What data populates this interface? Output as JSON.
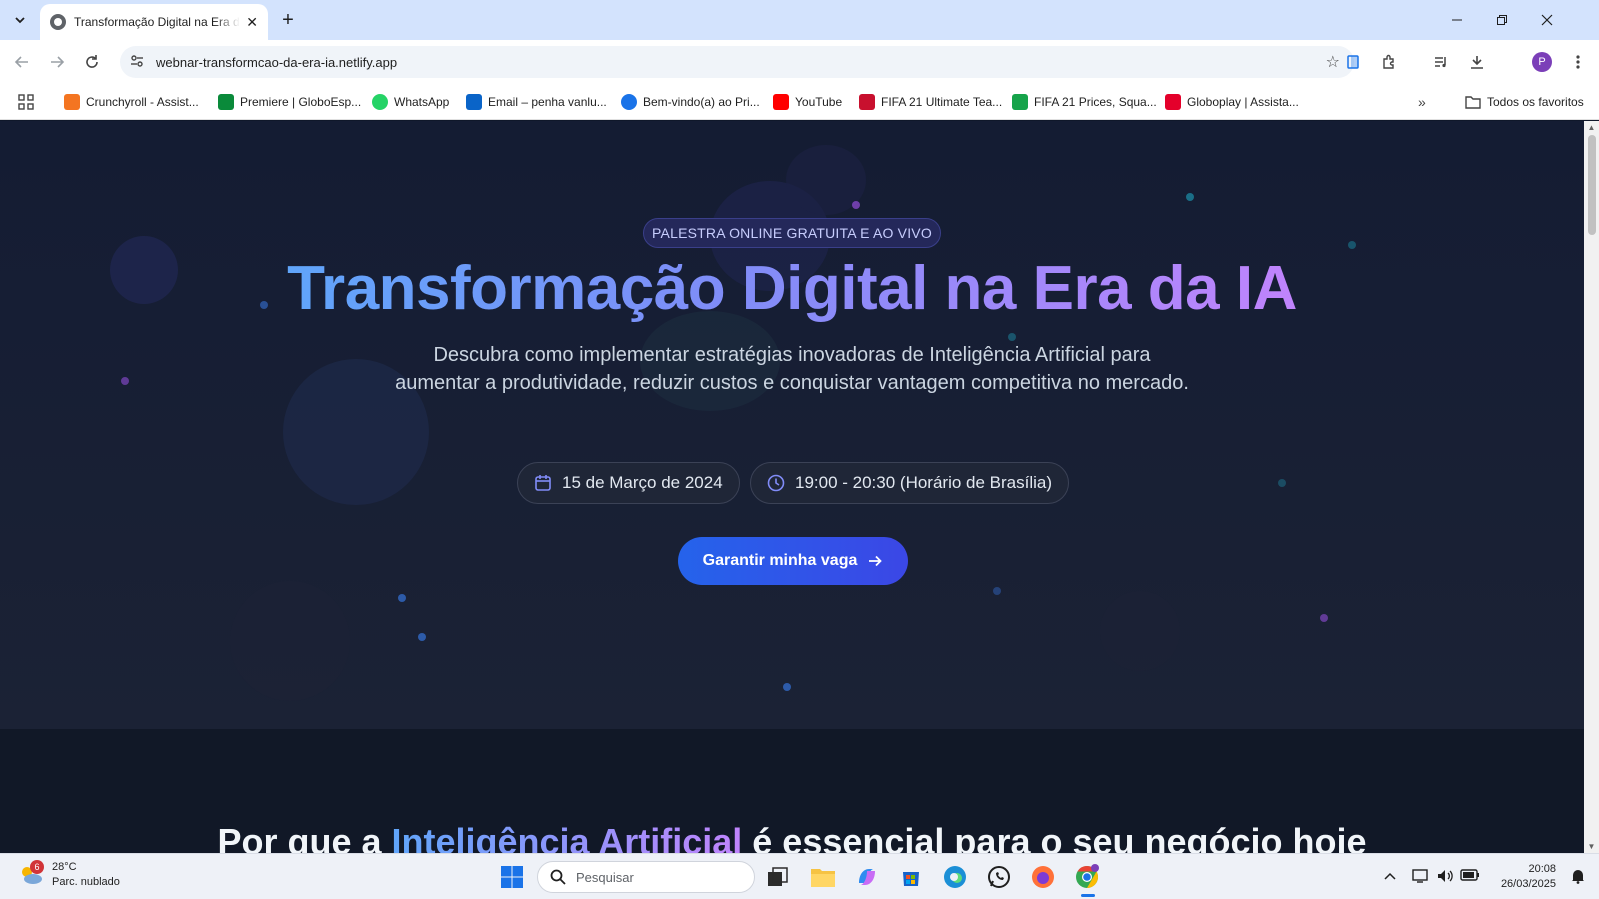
{
  "browser": {
    "tab_title": "Transformação Digital na Era da IA",
    "url": "webnar-transformcao-da-era-ia.netlify.app",
    "bookmarks": [
      {
        "label": "Crunchyroll - Assist...",
        "color": "#f47521"
      },
      {
        "label": "Premiere | GloboEsp...",
        "color": "#0a8a3a"
      },
      {
        "label": "WhatsApp",
        "color": "#25d366"
      },
      {
        "label": "Email – penha vanlu...",
        "color": "#0a64c8"
      },
      {
        "label": "Bem-vindo(a) ao Pri...",
        "color": "#1a73e8"
      },
      {
        "label": "YouTube",
        "color": "#ff0000"
      },
      {
        "label": "FIFA 21 Ultimate Tea...",
        "color": "#c8102e"
      },
      {
        "label": "FIFA 21 Prices, Squa...",
        "color": "#16a34a"
      },
      {
        "label": "Globoplay | Assista...",
        "color": "#e4002b"
      }
    ],
    "all_bookmarks_label": "Todos os favoritos",
    "profile_initial": "P"
  },
  "hero": {
    "badge": "PALESTRA ONLINE GRATUITA E AO VIVO",
    "title": "Transformação Digital na Era da IA",
    "subtitle": "Descubra como implementar estratégias inovadoras de Inteligência Artificial para aumentar a produtividade, reduzir custos e conquistar vantagem competitiva no mercado.",
    "date": "15 de Março de 2024",
    "time": "19:00 - 20:30 (Horário de Brasília)",
    "cta": "Garantir minha vaga"
  },
  "section2": {
    "title_before": "Por que a ",
    "title_highlight": "Inteligência Artificial",
    "title_after": " é essencial para o seu negócio hoje"
  },
  "taskbar": {
    "weather_temp": "28°C",
    "weather_desc": "Parc. nublado",
    "weather_badge": "6",
    "search_placeholder": "Pesquisar",
    "time": "20:08",
    "date": "26/03/2025"
  },
  "colors": {
    "accent": "#2563eb",
    "gradient_start": "#60a5fa",
    "gradient_end": "#c084fc",
    "hero_bg": "#141c33"
  }
}
